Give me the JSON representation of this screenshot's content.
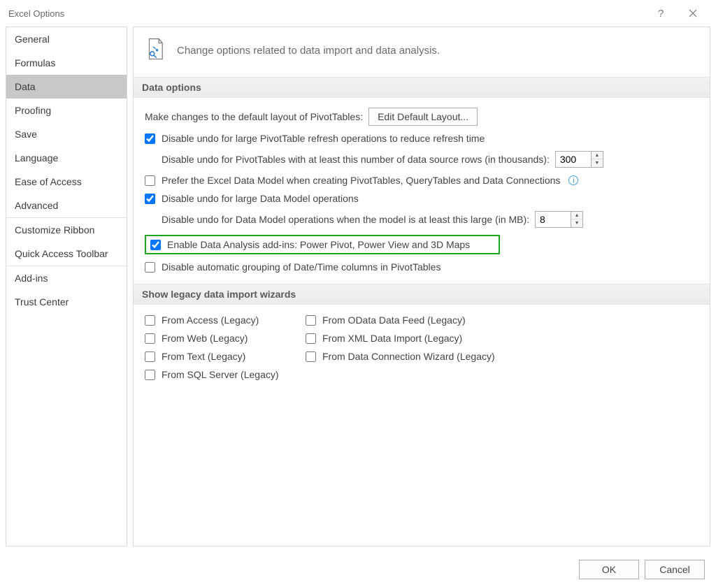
{
  "window": {
    "title": "Excel Options",
    "help_icon": "?",
    "close_icon": "close"
  },
  "sidebar": {
    "items": [
      {
        "label": "General"
      },
      {
        "label": "Formulas"
      },
      {
        "label": "Data",
        "selected": true
      },
      {
        "label": "Proofing"
      },
      {
        "label": "Save"
      },
      {
        "label": "Language"
      },
      {
        "label": "Ease of Access"
      },
      {
        "label": "Advanced"
      }
    ],
    "group2": [
      {
        "label": "Customize Ribbon"
      },
      {
        "label": "Quick Access Toolbar"
      }
    ],
    "group3": [
      {
        "label": "Add-ins"
      },
      {
        "label": "Trust Center"
      }
    ]
  },
  "header": {
    "text": "Change options related to data import and data analysis."
  },
  "sections": {
    "data_options": {
      "title": "Data options",
      "pivot_layout_label": "Make changes to the default layout of PivotTables:",
      "edit_default_btn": "Edit Default Layout...",
      "disable_undo_pivot": "Disable undo for large PivotTable refresh operations to reduce refresh time",
      "disable_undo_pivot_rows_label": "Disable undo for PivotTables with at least this number of data source rows (in thousands):",
      "disable_undo_pivot_rows_value": "300",
      "prefer_data_model": "Prefer the Excel Data Model when creating PivotTables, QueryTables and Data Connections",
      "disable_undo_dm": "Disable undo for large Data Model operations",
      "disable_undo_dm_mb_label": "Disable undo for Data Model operations when the model is at least this large (in MB):",
      "disable_undo_dm_mb_value": "8",
      "enable_addins": "Enable Data Analysis add-ins: Power Pivot, Power View and 3D Maps",
      "disable_auto_group": "Disable automatic grouping of Date/Time columns in PivotTables"
    },
    "legacy": {
      "title": "Show legacy data import wizards",
      "from_access": "From Access (Legacy)",
      "from_web": "From Web (Legacy)",
      "from_text": "From Text (Legacy)",
      "from_sql": "From SQL Server (Legacy)",
      "from_odata": "From OData Data Feed (Legacy)",
      "from_xml": "From XML Data Import (Legacy)",
      "from_dcw": "From Data Connection Wizard (Legacy)"
    }
  },
  "footer": {
    "ok": "OK",
    "cancel": "Cancel"
  }
}
